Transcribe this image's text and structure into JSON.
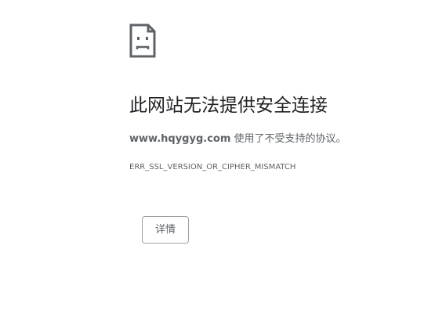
{
  "error": {
    "icon": "sad-page-icon",
    "heading": "此网站无法提供安全连接",
    "host": "www.hqygyg.com",
    "message_suffix": " 使用了不受支持的协议。",
    "code": "ERR_SSL_VERSION_OR_CIPHER_MISMATCH"
  },
  "actions": {
    "details_label": "详情"
  }
}
